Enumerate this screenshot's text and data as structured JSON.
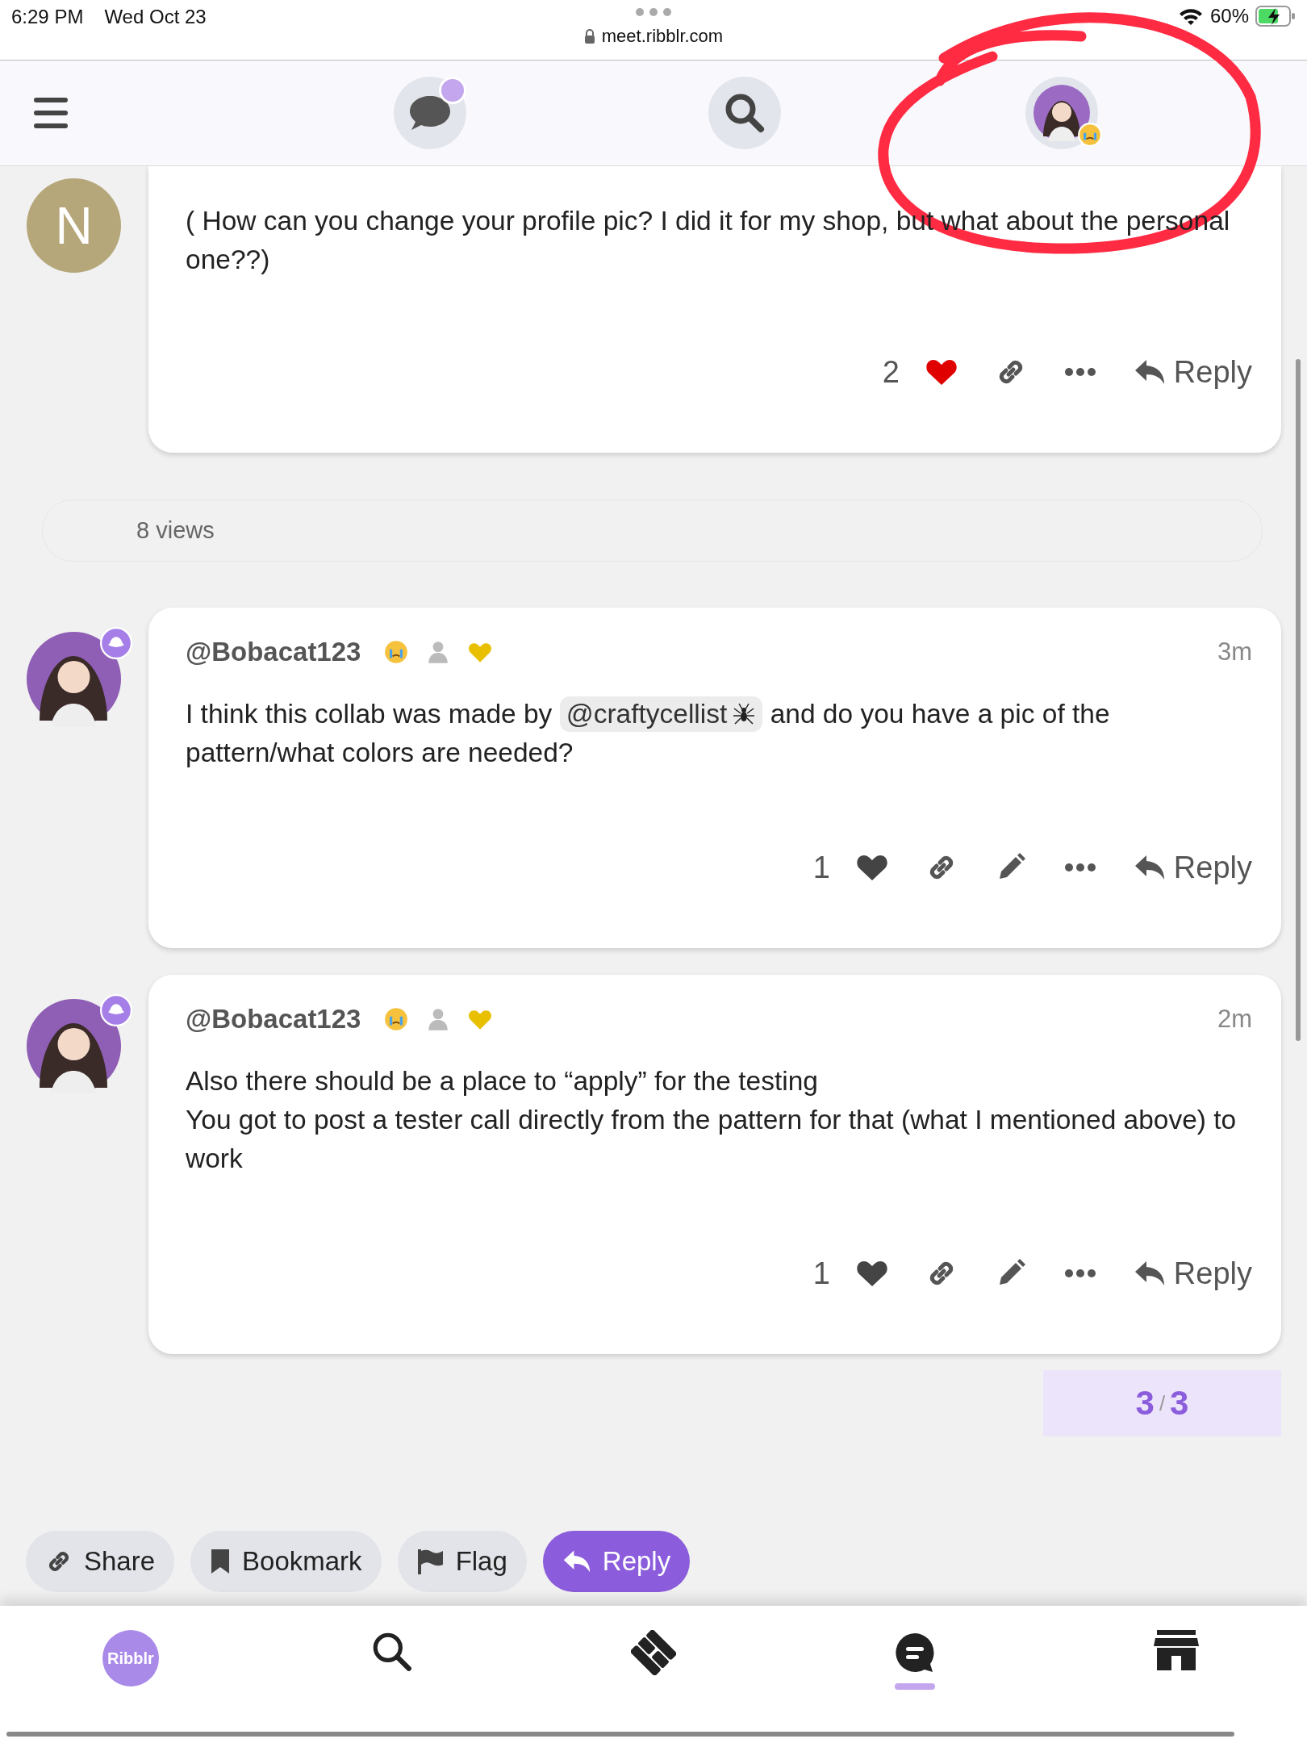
{
  "status_bar": {
    "time": "6:29 PM",
    "date": "Wed Oct 23",
    "url": "meet.ribblr.com",
    "battery": "60%"
  },
  "posts": [
    {
      "avatar": {
        "kind": "letter",
        "letter": "N",
        "color": "#b5a77a"
      },
      "body": [
        [
          {
            "kind": "text",
            "text": "( How can you change your profile pic? I did it for my shop, but what about the personal one??)"
          }
        ]
      ],
      "likes": "2",
      "liked": true,
      "editable": false,
      "reply": "Reply"
    },
    {
      "avatar": {
        "kind": "picture"
      },
      "author": "@Bobacat123",
      "time": "3m",
      "body": [
        [
          {
            "kind": "text",
            "text": "I think this collab was made by"
          },
          {
            "kind": "mention",
            "text": "@craftycellist"
          },
          {
            "kind": "text",
            "text": "and do you have a pic of the pattern/what colors are needed?"
          }
        ]
      ],
      "likes": "1",
      "liked": false,
      "editable": true,
      "reply": "Reply"
    },
    {
      "avatar": {
        "kind": "picture"
      },
      "author": "@Bobacat123",
      "time": "2m",
      "body": [
        [
          {
            "kind": "text",
            "text": "Also there should be a place to “apply” for the testing"
          }
        ],
        [
          {
            "kind": "text",
            "text": "You got to post a tester call directly from the pattern for that (what I mentioned above) to work"
          }
        ]
      ],
      "likes": "1",
      "liked": false,
      "editable": true,
      "reply": "Reply"
    }
  ],
  "views": "8 views",
  "post_counter": {
    "current": "3",
    "separator": "/",
    "total": "3"
  },
  "bottom_actions": [
    {
      "kind": "share",
      "label": "Share"
    },
    {
      "kind": "bookmark",
      "label": "Bookmark"
    },
    {
      "kind": "flag",
      "label": "Flag"
    },
    {
      "kind": "reply",
      "label": "Reply"
    }
  ],
  "tab_bar": [
    {
      "kind": "logo",
      "label": "Ribblr",
      "selected": false
    },
    {
      "kind": "search",
      "selected": false
    },
    {
      "kind": "patterns",
      "selected": false
    },
    {
      "kind": "chat",
      "selected": true
    },
    {
      "kind": "shop",
      "selected": false
    }
  ]
}
